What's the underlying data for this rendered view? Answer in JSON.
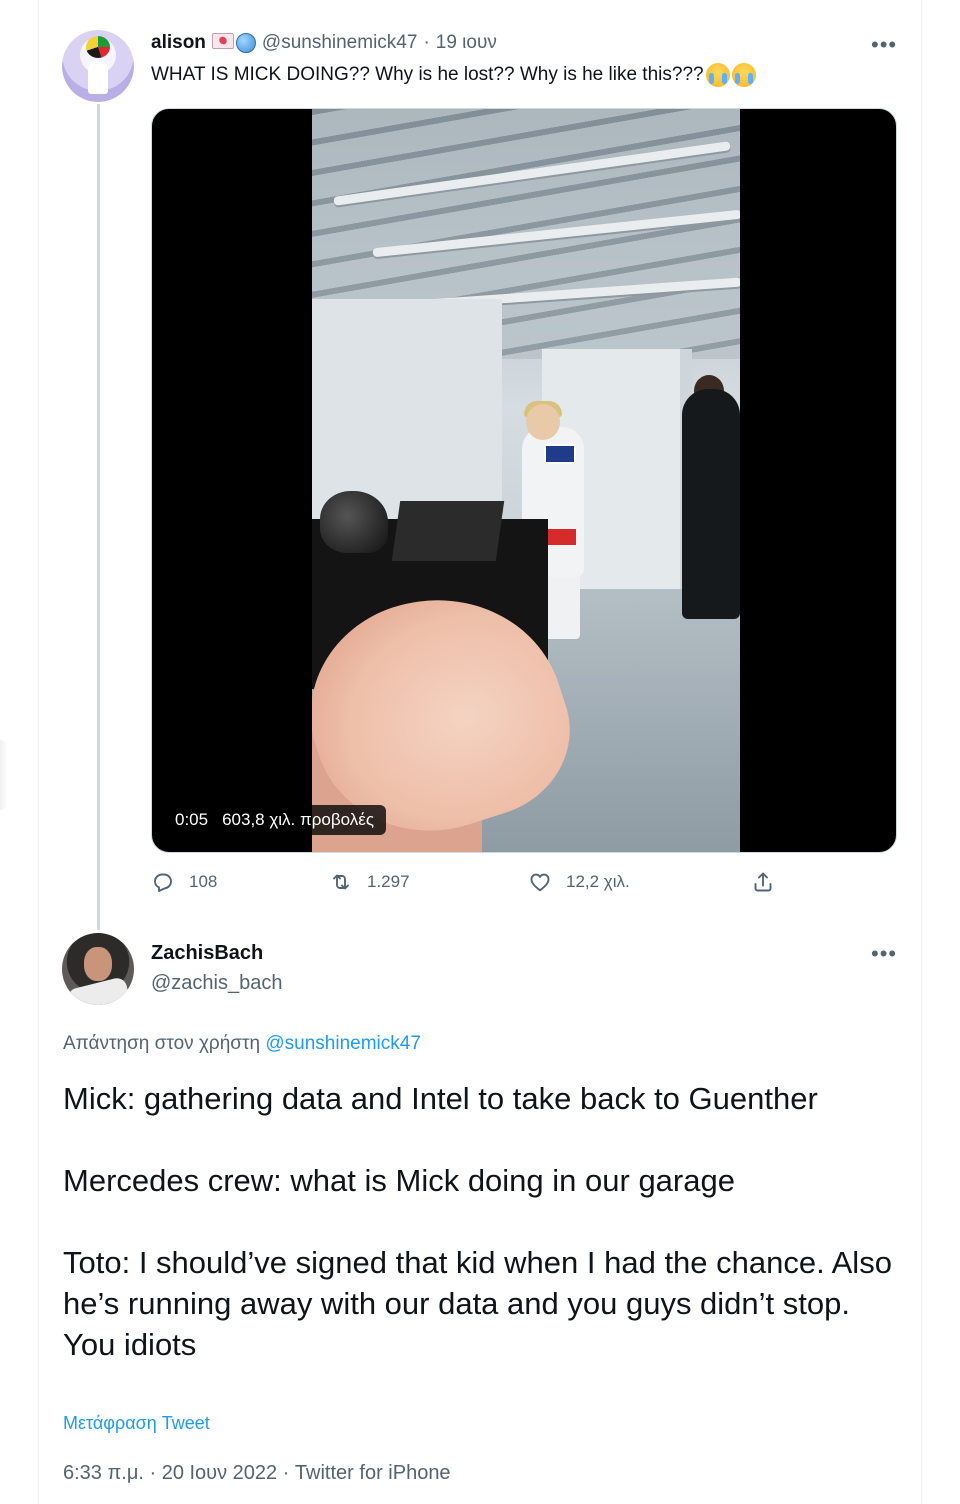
{
  "tweet": {
    "author_name": "alison",
    "author_handle": "@sunshinemick47",
    "separator": "·",
    "time": "19 ιουν",
    "text": "WHAT IS MICK DOING?? Why is he lost?? Why is he like this???",
    "video": {
      "elapsed": "0:05",
      "views": "603,8 χιλ. προβολές"
    },
    "actions": {
      "replies": "108",
      "retweets": "1.297",
      "likes": "12,2 χιλ."
    }
  },
  "reply": {
    "author_name": "ZachisBach",
    "author_handle": "@zachis_bach",
    "reply_prefix": "Απάντηση στον χρήστη",
    "reply_mention": "@sunshinemick47",
    "paragraphs": [
      "Mick: gathering data and Intel to take back to Guenther",
      "Mercedes crew: what is Mick doing in our garage",
      "Toto: I should’ve signed that kid when I had the chance. Also he’s running away with our data and you guys didn’t stop. You idiots"
    ],
    "translate_label": "Μετάφραση Tweet",
    "meta": "6:33 π.μ. · 20 Ιουν 2022 · Twitter for iPhone"
  },
  "colors": {
    "text": "#0f1419",
    "secondary": "#536471",
    "link": "#1d9bf0",
    "border": "#eff3f4"
  },
  "icons": [
    "more-icon",
    "reply-icon",
    "retweet-icon",
    "like-icon",
    "share-icon",
    "email-emoji-icon",
    "globe-emoji-icon",
    "crying-face-icon"
  ]
}
